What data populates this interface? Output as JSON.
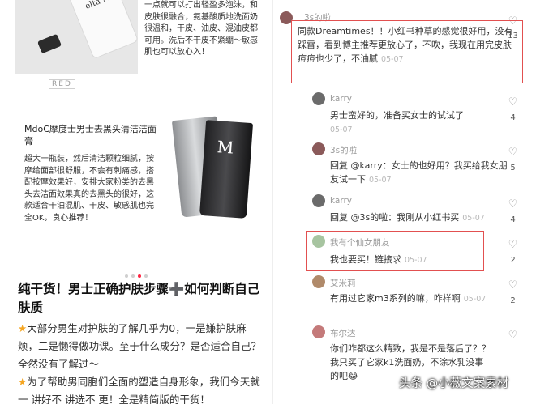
{
  "left": {
    "top_text": [
      "一点就可以打出轻盈多泡沫，和皮肤很融合，氨基酸质地洗面奶很温和，干皮、油皮、混油皮都可用。洗后不干皮不紧绷～敏感肌也可以放心入！"
    ],
    "red_mark": "RED",
    "product_title": "MdoC摩度士男士去黑头清洁洁面膏",
    "product_desc": "超大一瓶装，然后清洁颗粒细腻，按摩给面部很舒服，不会有刺痛感，搭配按摩效果好，安排大家粉类的去黑头去洁面效果真的去黑头的很好，这款适合干油混肌、干皮、敏感肌也完全OK，良心推荐！",
    "bottle_label": "elta MD",
    "tube_mark": "M",
    "article_title": "纯干货！男士正确护肤步骤➕如何判断自己肤质",
    "article_p1": "大部分男生对护肤的了解几乎为0，一是嫌护肤麻烦，二是懒得做功课。至于什么成分？是否适合自己？全然没有了解过～",
    "article_p2": "为了帮助男同胞们全面的塑造自身形象，我们今天就一 讲好不 讲选不 更！全是精简版的干货！",
    "star_icon": "star-icon"
  },
  "comments": [
    {
      "user": "3s的啦",
      "text": "同款Dreamtimes！！小红书种草的感觉很好用，没有踩雷，看到博主推荐更放心了，不吹，我现在用完皮肤痘痘也少了，不油腻",
      "time": "05-07",
      "likes": "13",
      "reply_to": ""
    },
    {
      "user": "karry",
      "text": "男士蛮好的，准备买女士的试试了",
      "time": "05-07",
      "likes": "4",
      "reply_to": ""
    },
    {
      "user": "3s的啦",
      "text": "回复 @karry：女士的也好用？我买给我女朋友试一下",
      "time": "05-07",
      "likes": "5",
      "reply_to": "@karry"
    },
    {
      "user": "karry",
      "text": "回复 @3s的啦：我刚从小红书买",
      "time": "05-07",
      "likes": "4",
      "reply_to": "@3s的啦"
    },
    {
      "user": "我有个仙女朋友",
      "text": "我也要买！链接求",
      "time": "05-07",
      "likes": "2",
      "reply_to": ""
    },
    {
      "user": "艾米莉",
      "text": "有用过它家m3系列的嘛，咋样啊",
      "time": "05-07",
      "likes": "2",
      "reply_to": ""
    },
    {
      "user": "布尔达",
      "text": "你们咋都这么精致，我是不是落后了？？我只买了它家k1洗面奶，不涂水乳没事的吧😂",
      "time": "05-07",
      "likes": "",
      "reply_to": ""
    }
  ],
  "watermark": "头条 @小薇文案素材",
  "accent": "#ff2442",
  "mention_color": "#4a76b3",
  "highlight_color": "#e25050"
}
